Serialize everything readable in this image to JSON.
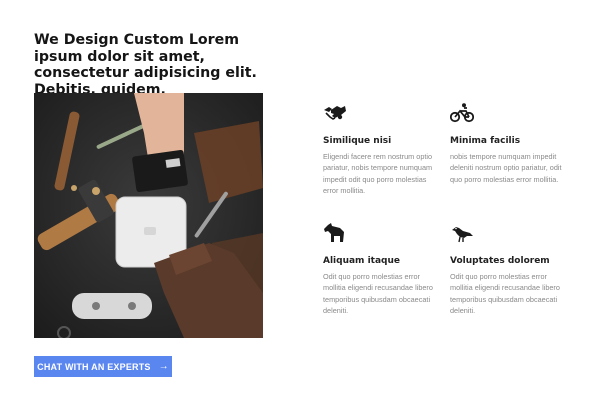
{
  "headline": "We Design Custom Lorem ipsum dolor sit amet, consectetur adipisicing elit. Debitis, quidem.",
  "cta": {
    "label": "CHAT WITH AN EXPERTS",
    "icon": "arrow-right-icon"
  },
  "features": [
    {
      "icon": "handshake-icon",
      "title": "Similique nisi",
      "body": "Eligendi facere rem nostrum optio pariatur, nobis tempore numquam impedit odit quo porro molestias error mollitia."
    },
    {
      "icon": "bicycle-icon",
      "title": "Minima facilis",
      "body": "nobis tempore numquam impedit deleniti nostrum optio pariatur, odit quo porro molestias error mollitia."
    },
    {
      "icon": "horse-icon",
      "title": "Aliquam itaque",
      "body": "Odit quo porro molestias error mollitia eligendi recusandae libero temporibus quibusdam obcaecati deleniti."
    },
    {
      "icon": "bird-icon",
      "title": "Voluptates dolorem",
      "body": "Odit quo porro molestias error mollitia eligendi recusandae libero temporibus quibusdam obcaecati deleniti."
    }
  ],
  "colors": {
    "accent": "#5a86f0",
    "heading": "#151515",
    "muted": "#8a8a8a"
  }
}
